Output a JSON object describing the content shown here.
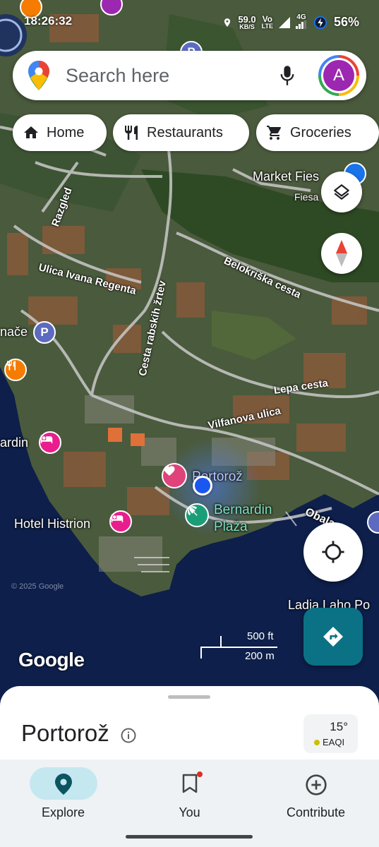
{
  "status_bar": {
    "time": "18:26:32",
    "net_speed_value": "59.0",
    "net_speed_unit": "KB/S",
    "volte_top": "Vo",
    "volte_bottom": "LTE",
    "network": "4G",
    "battery": "56%"
  },
  "search": {
    "placeholder": "Search here",
    "avatar_letter": "A"
  },
  "chips": [
    {
      "label": "Home",
      "icon": "home-icon"
    },
    {
      "label": "Restaurants",
      "icon": "restaurant-icon"
    },
    {
      "label": "Groceries",
      "icon": "cart-icon"
    }
  ],
  "map": {
    "place_labels": {
      "market": "Market Fies",
      "market_sub": "Fiesa",
      "portoroz": "Portorož",
      "bernardin_1": "Bernardin",
      "bernardin_2": "Plaža",
      "hotel_histrion": "Hotel Histrion",
      "ardin": "ardin",
      "nace": "nače",
      "ladja": "Ladja Laho Po",
      "obala": "Obala"
    },
    "road_labels": {
      "razgled": "Razgled",
      "ivana_regenta": "Ulica Ivana Regenta",
      "rabskih": "Cesta rabskih žrtev",
      "belokriska": "Belokriška cesta",
      "lepa": "Lepa cesta",
      "vilfanova": "Vilfanova ulica"
    },
    "scale_ft": "500 ft",
    "scale_m": "200 m",
    "logo": "Google",
    "copyright": "© 2025 Google"
  },
  "sheet": {
    "title": "Portorož",
    "temperature": "15°",
    "aqi_label": "EAQI"
  },
  "bottom_nav": [
    {
      "label": "Explore",
      "active": true,
      "icon": "explore-pin-icon"
    },
    {
      "label": "You",
      "active": false,
      "icon": "bookmark-icon"
    },
    {
      "label": "Contribute",
      "active": false,
      "icon": "add-circle-icon"
    }
  ],
  "colors": {
    "directions_fab": "#0b7285",
    "explore_pill": "#c5e7f0",
    "avatar": "#9c27b0",
    "location_dot": "#1a57f0",
    "hotel_pin": "#e91e8c",
    "restaurant_pin": "#f57c00",
    "parking_pin": "#5c6bc0"
  }
}
